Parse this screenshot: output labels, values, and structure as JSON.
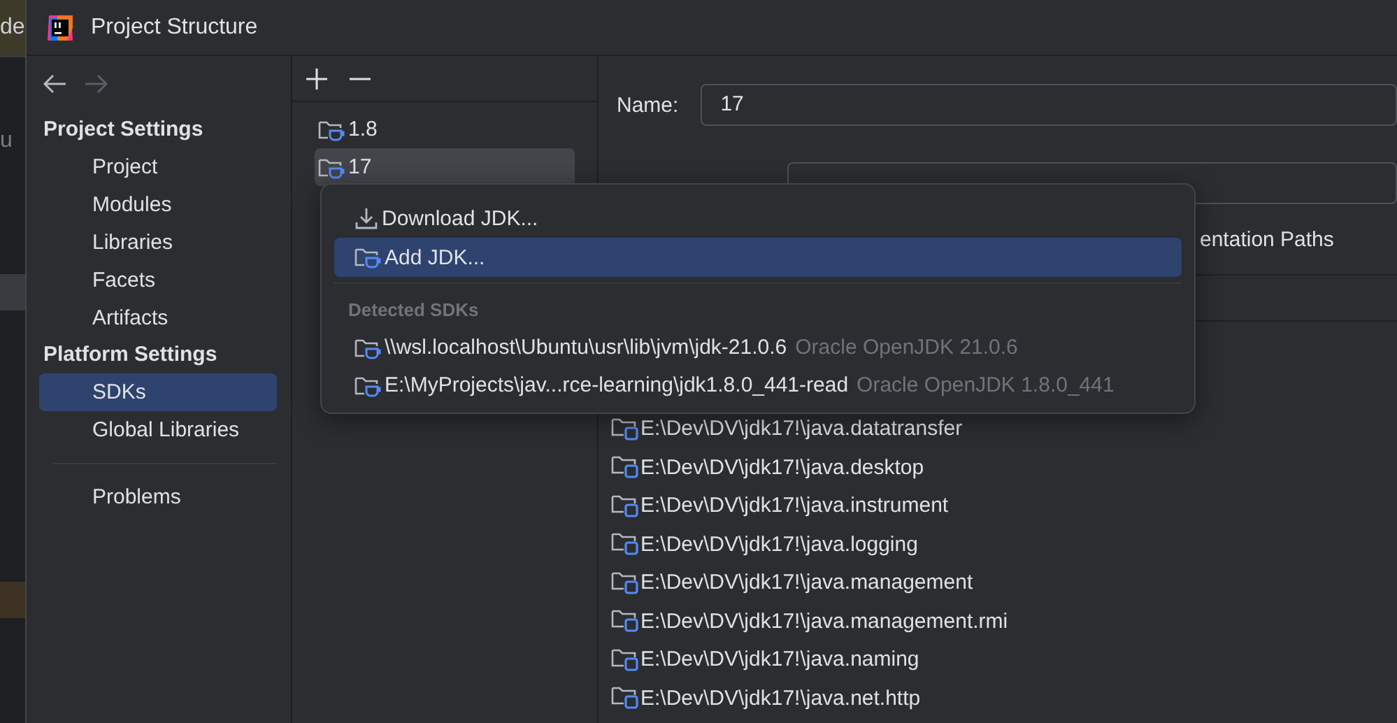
{
  "background_window": {
    "texts": [
      "de",
      "u"
    ]
  },
  "window": {
    "title": "Project Structure"
  },
  "navigation": {
    "back_enabled": true,
    "forward_enabled": false
  },
  "sidebar": {
    "sections": [
      {
        "heading": "Project Settings",
        "items": [
          {
            "label": "Project",
            "selected": false
          },
          {
            "label": "Modules",
            "selected": false
          },
          {
            "label": "Libraries",
            "selected": false
          },
          {
            "label": "Facets",
            "selected": false
          },
          {
            "label": "Artifacts",
            "selected": false
          }
        ]
      },
      {
        "heading": "Platform Settings",
        "items": [
          {
            "label": "SDKs",
            "selected": true
          },
          {
            "label": "Global Libraries",
            "selected": false
          }
        ]
      },
      {
        "items": [
          {
            "label": "Problems",
            "selected": false
          }
        ]
      }
    ]
  },
  "sdk_list": {
    "items": [
      {
        "label": "1.8",
        "selected": false
      },
      {
        "label": "17",
        "selected": true
      }
    ]
  },
  "detail": {
    "name_label": "Name:",
    "name_value": "17",
    "tab": "entation Paths",
    "paths": [
      "E:\\Dev\\DV\\jdk17!\\java.datatransfer",
      "E:\\Dev\\DV\\jdk17!\\java.desktop",
      "E:\\Dev\\DV\\jdk17!\\java.instrument",
      "E:\\Dev\\DV\\jdk17!\\java.logging",
      "E:\\Dev\\DV\\jdk17!\\java.management",
      "E:\\Dev\\DV\\jdk17!\\java.management.rmi",
      "E:\\Dev\\DV\\jdk17!\\java.naming",
      "E:\\Dev\\DV\\jdk17!\\java.net.http"
    ]
  },
  "popup": {
    "actions": [
      {
        "kind": "download",
        "label": "Download JDK...",
        "selected": false
      },
      {
        "kind": "add",
        "label": "Add JDK...",
        "selected": true
      }
    ],
    "group_heading": "Detected SDKs",
    "detected": [
      {
        "path": "\\\\wsl.localhost\\Ubuntu\\usr\\lib\\jvm\\jdk-21.0.6",
        "version": "Oracle OpenJDK 21.0.6"
      },
      {
        "path": "E:\\MyProjects\\jav...rce-learning\\jdk1.8.0_441-read",
        "version": "Oracle OpenJDK 1.8.0_441"
      }
    ]
  }
}
